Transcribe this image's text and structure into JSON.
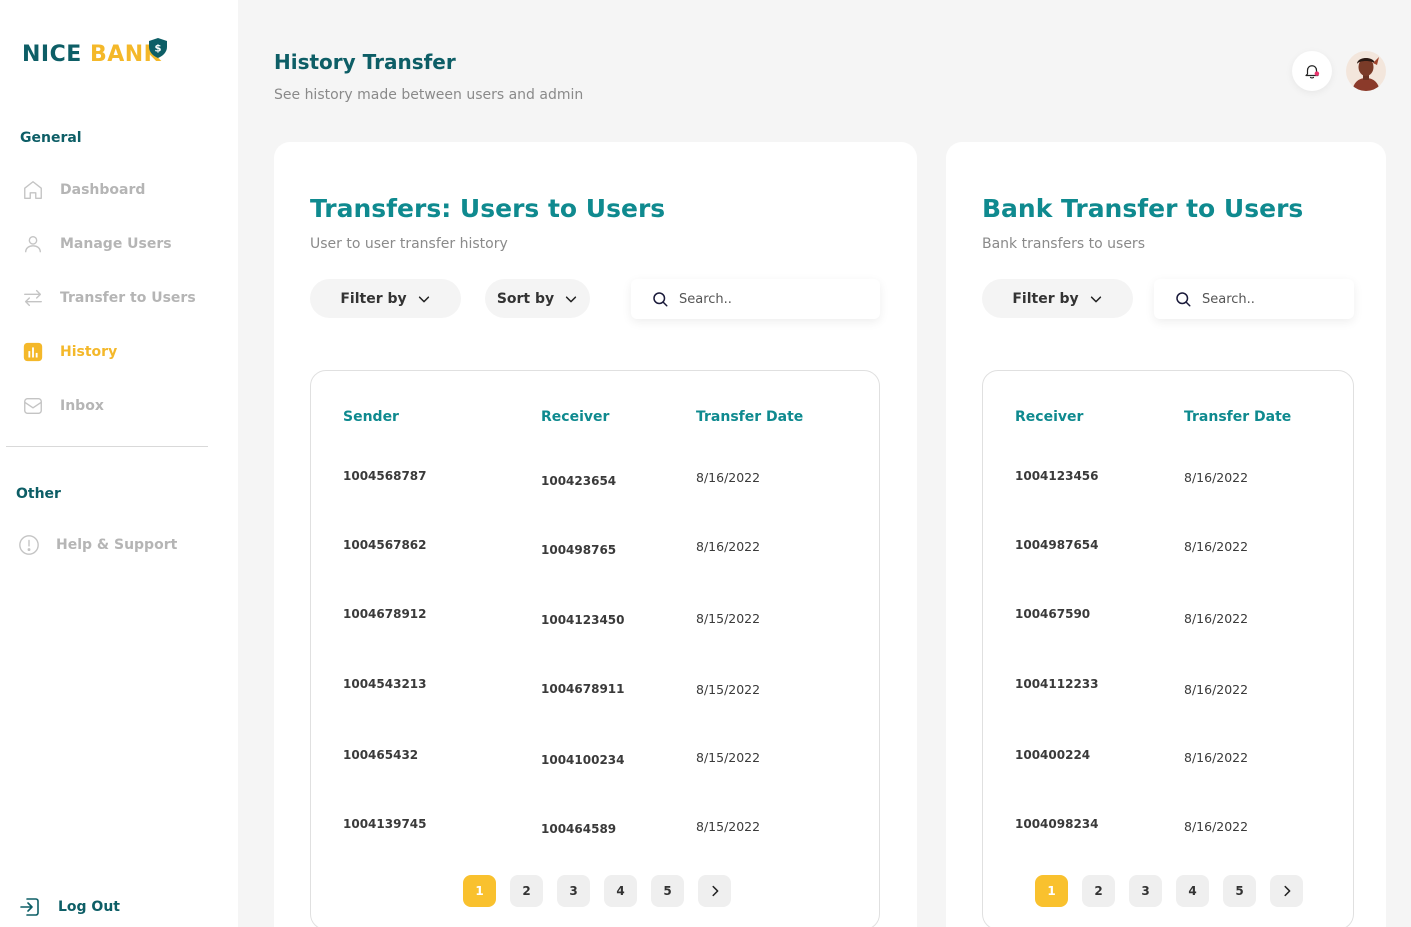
{
  "brand": {
    "name_part1": "NICE",
    "name_part2": "BANK",
    "shield_symbol": "$"
  },
  "sidebar": {
    "general_title": "General",
    "items": [
      {
        "label": "Dashboard",
        "icon": "home-icon",
        "active": false
      },
      {
        "label": "Manage Users",
        "icon": "user-icon",
        "active": false
      },
      {
        "label": "Transfer to Users",
        "icon": "transfer-arrows-icon",
        "active": false
      },
      {
        "label": "History",
        "icon": "chart-icon",
        "active": true
      },
      {
        "label": "Inbox",
        "icon": "mail-icon",
        "active": false
      }
    ],
    "other_title": "Other",
    "help_label": "Help & Support",
    "logout_label": "Log Out"
  },
  "header": {
    "title": "History Transfer",
    "subtitle": "See history made between users and admin"
  },
  "users_card": {
    "title": "Transfers: Users to Users",
    "subtitle": "User to user transfer history",
    "filter_label": "Filter by",
    "sort_label": "Sort by",
    "search_placeholder": "Search..",
    "columns": [
      "Sender",
      "Receiver",
      "Transfer Date"
    ],
    "rows": [
      [
        "1004568787",
        "100423654",
        "8/16/2022"
      ],
      [
        "1004567862",
        "100498765",
        "8/16/2022"
      ],
      [
        "1004678912",
        "1004123450",
        "8/15/2022"
      ],
      [
        "1004543213",
        "1004678911",
        "8/15/2022"
      ],
      [
        "100465432",
        "1004100234",
        "8/15/2022"
      ],
      [
        "1004139745",
        "100464589",
        "8/15/2022"
      ]
    ],
    "pages": [
      "1",
      "2",
      "3",
      "4",
      "5"
    ],
    "current_page": "1"
  },
  "bank_card": {
    "title": "Bank Transfer to Users",
    "subtitle": "Bank transfers to users",
    "filter_label": "Filter by",
    "search_placeholder": "Search..",
    "columns": [
      "Receiver",
      "Transfer Date"
    ],
    "rows": [
      [
        "1004123456",
        "8/16/2022"
      ],
      [
        "1004987654",
        "8/16/2022"
      ],
      [
        "100467590",
        "8/16/2022"
      ],
      [
        "1004112233",
        "8/16/2022"
      ],
      [
        "100400224",
        "8/16/2022"
      ],
      [
        "1004098234",
        "8/16/2022"
      ]
    ],
    "pages": [
      "1",
      "2",
      "3",
      "4",
      "5"
    ],
    "current_page": "1"
  },
  "colors": {
    "brand_teal": "#0d5e66",
    "accent_teal": "#0f8a8f",
    "accent_yellow": "#f4b82a",
    "notification_dot": "#e8336d"
  }
}
